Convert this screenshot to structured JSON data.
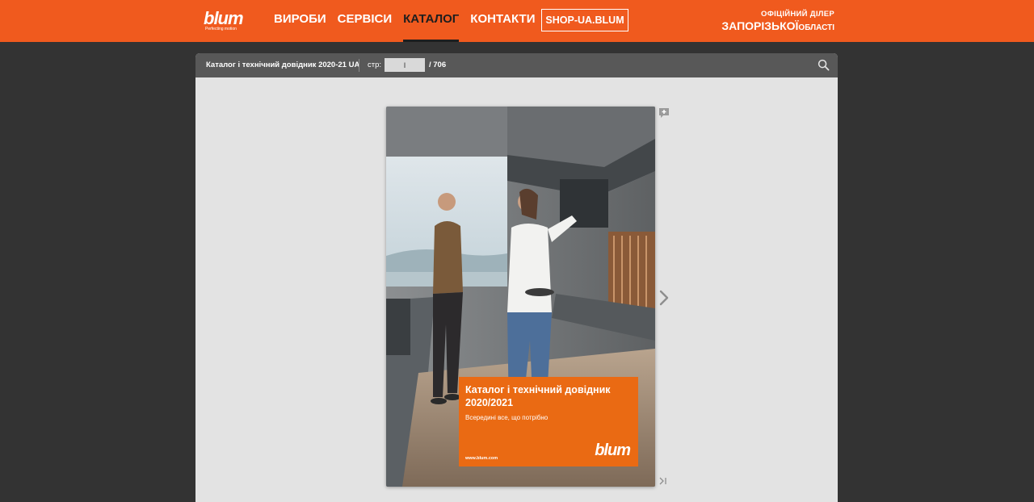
{
  "header": {
    "logo": {
      "word": "blum",
      "tagline": "Perfecting motion"
    },
    "nav": [
      {
        "label": "ВИРОБИ",
        "active": false
      },
      {
        "label": "СЕРВІСИ",
        "active": false
      },
      {
        "label": "КАТАЛОГ",
        "active": true
      },
      {
        "label": "КОНТАКТИ",
        "active": false
      }
    ],
    "shop_button": "SHOP-UA.BLUM",
    "dealer": {
      "line1": "ОФІЦІЙНИЙ ДІЛЕР",
      "region": "ЗАПОРІЗЬКОЇ",
      "suffix": "ОБЛАСТІ"
    }
  },
  "viewer": {
    "toolbar": {
      "title": "Каталог і технічний довідник 2020-21 UA",
      "page_label": "стр:",
      "page_value": "I",
      "page_total": "/  706"
    },
    "cover": {
      "title": "Каталог і технічний довідник 2020/2021",
      "subtitle": "Всередині все, що потрібно",
      "url": "www.blum.com",
      "logo": "blum"
    }
  },
  "colors": {
    "brand_orange": "#f05a1e",
    "promo_orange": "#ea6a13",
    "toolbar": "#585858",
    "viewer_bg": "#e3e3e3",
    "page_bg": "#333333"
  },
  "icons": [
    "search-icon",
    "add-note-icon",
    "chevron-right-icon",
    "last-page-icon"
  ]
}
